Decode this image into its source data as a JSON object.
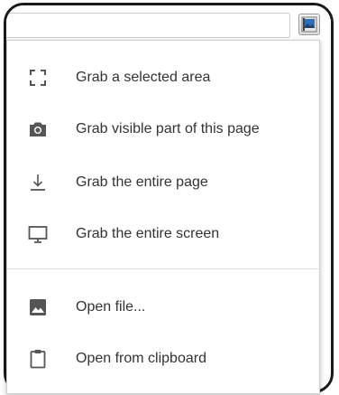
{
  "colors": {
    "icon": "#555555",
    "text": "#333333",
    "separator": "#e0e0e0",
    "ext_icon_blue": "#2e6fb8",
    "ext_icon_dark": "#1e3f66"
  },
  "toolbar": {
    "extension_icon": "screenshot-extension-icon"
  },
  "menu": {
    "capture_items": [
      {
        "label": "Grab a selected area",
        "icon": "selection-corners-icon"
      },
      {
        "label": "Grab visible part of this page",
        "icon": "camera-icon"
      },
      {
        "label": "Grab the entire page",
        "icon": "download-arrow-icon"
      },
      {
        "label": "Grab the entire screen",
        "icon": "monitor-icon"
      }
    ],
    "file_items": [
      {
        "label": "Open file...",
        "icon": "image-icon"
      },
      {
        "label": "Open from clipboard",
        "icon": "clipboard-icon"
      }
    ]
  }
}
